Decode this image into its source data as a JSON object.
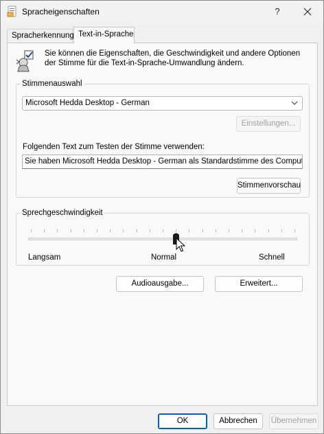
{
  "window": {
    "title": "Spracheigenschaften",
    "help_label": "?"
  },
  "tabs": [
    {
      "label": "Spracherkennung",
      "active": false
    },
    {
      "label": "Text-in-Sprache",
      "active": true
    }
  ],
  "intro_text": "Sie können die Eigenschaften, die Geschwindigkeit und andere Optionen der Stimme für die Text-in-Sprache-Umwandlung ändern.",
  "voice_selection": {
    "group_label": "Stimmenauswahl",
    "selected_voice": "Microsoft Hedda Desktop - German",
    "settings_button": "Einstellungen...",
    "settings_enabled": false,
    "test_text_label": "Folgenden Text zum Testen der Stimme verwenden:",
    "test_text_value": "Sie haben Microsoft Hedda Desktop - German als Standardstimme des Computers ausgewählt.",
    "preview_button": "Stimmenvorschau"
  },
  "speech_rate": {
    "group_label": "Sprechgeschwindigkeit",
    "label_slow": "Langsam",
    "label_normal": "Normal",
    "label_fast": "Schnell",
    "tick_count": 21,
    "value_fraction": 0.55
  },
  "buttons": {
    "audio_output": "Audioausgabe...",
    "advanced": "Erweitert...",
    "ok": "OK",
    "cancel": "Abbrechen",
    "apply": "Übernehmen",
    "apply_enabled": false
  },
  "colors": {
    "accent": "#005fb8",
    "disabled_text": "#a0a0a0"
  },
  "icons": {
    "title_icon": "speech-properties-icon",
    "agent_icon": "text-to-speech-agent-icon",
    "close_icon": "close-icon",
    "dropdown_icon": "chevron-down-icon",
    "cursor": "mouse-pointer"
  }
}
